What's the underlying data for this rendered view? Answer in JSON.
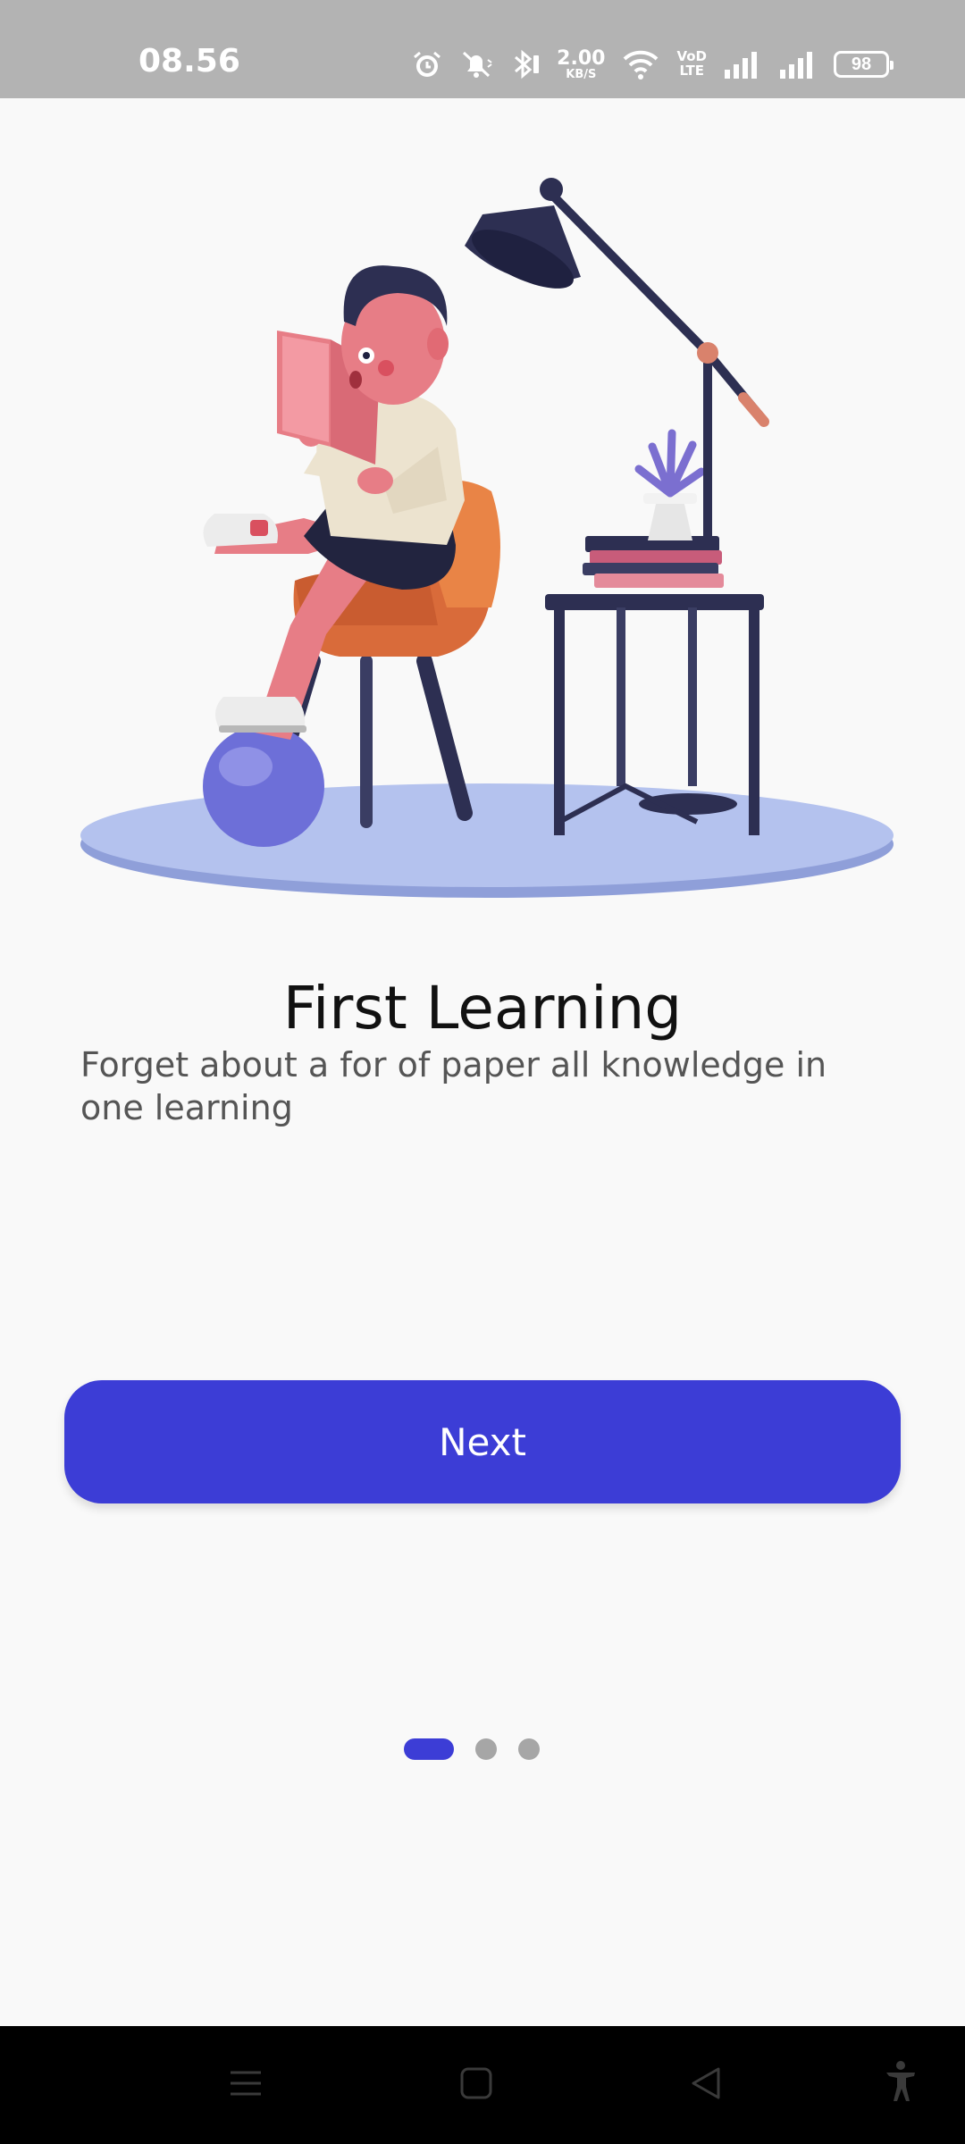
{
  "status_bar": {
    "time": "08.56",
    "speed_value": "2.00",
    "speed_unit": "KB/S",
    "network_label_top": "VoD",
    "network_label_bottom": "LTE",
    "battery": "98"
  },
  "onboarding": {
    "title": "First Learning",
    "description": "Forget about a for of paper all knowledge in one learning",
    "next_label": "Next",
    "page_indicator": {
      "total": 3,
      "current": 1
    }
  },
  "colors": {
    "accent": "#3c3dd6",
    "status_bar": "#b3b3b3",
    "background": "#f9f9f9",
    "dot_inactive": "#a6a6a6"
  },
  "icons": {
    "status": [
      "alarm-icon",
      "mute-icon",
      "bluetooth-icon",
      "wifi-icon",
      "signal-icon",
      "signal-icon",
      "battery-icon"
    ],
    "nav": [
      "menu-icon",
      "home-icon",
      "back-icon",
      "accessibility-icon"
    ]
  }
}
